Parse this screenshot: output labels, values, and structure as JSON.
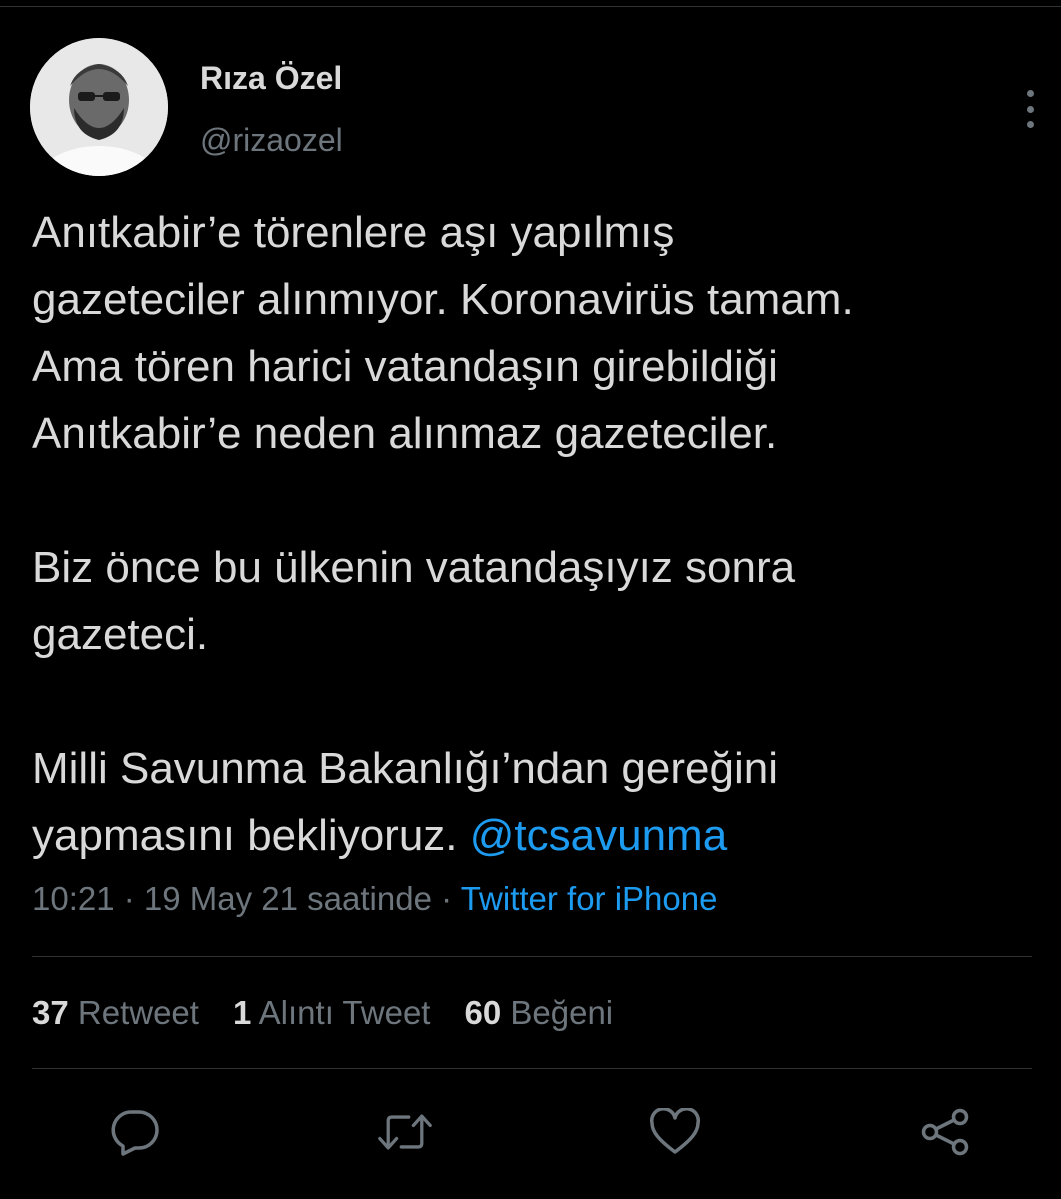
{
  "author": {
    "name": "Rıza Özel",
    "handle": "@rizaozel"
  },
  "tweet": {
    "paragraphs": [
      {
        "lines": [
          "Anıtkabir’e törenlere aşı yapılmış",
          "gazeteciler alınmıyor. Koronavirüs tamam.",
          "Ama tören harici vatandaşın girebildiği",
          "Anıtkabir’e neden alınmaz gazeteciler."
        ]
      },
      {
        "lines": [
          "Biz önce bu ülkenin vatandaşıyız sonra",
          "gazeteci."
        ]
      },
      {
        "lines": [
          "Milli Savunma Bakanlığı’ndan gereğini",
          "yapmasını bekliyoruz. "
        ],
        "mention": "@tcsavunma"
      }
    ]
  },
  "meta": {
    "time": "10:21",
    "separator": " · ",
    "date": "19 May 21 saatinde",
    "source": "Twitter for iPhone"
  },
  "stats": {
    "retweets": {
      "count": "37",
      "label": " Retweet"
    },
    "quotes": {
      "count": "1",
      "label": " Alıntı Tweet"
    },
    "likes": {
      "count": "60",
      "label": " Beğeni"
    }
  },
  "actions": [
    "reply-icon",
    "retweet-icon",
    "like-icon",
    "share-icon"
  ],
  "colors": {
    "background": "#000000",
    "text": "#d9d9d9",
    "secondary": "#6e767d",
    "accent": "#1d9bf0",
    "divider": "#2f3336"
  }
}
